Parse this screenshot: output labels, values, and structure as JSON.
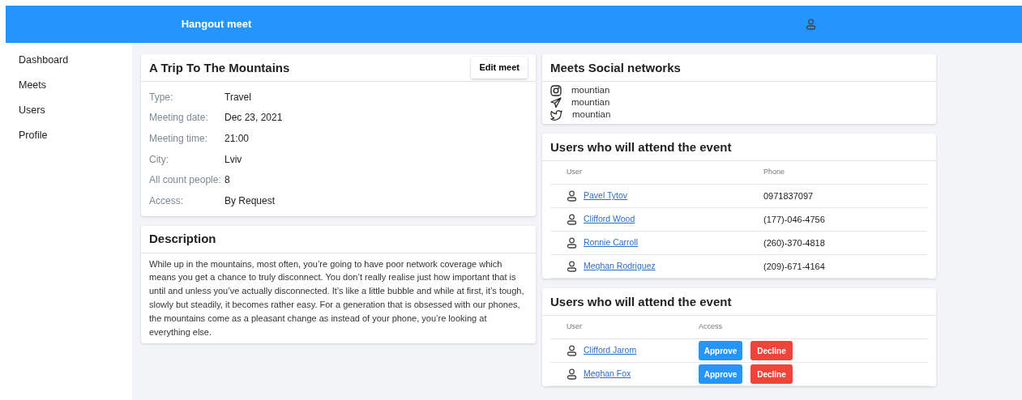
{
  "navbar": {
    "title": "Hangout meet"
  },
  "sidebar": {
    "items": [
      {
        "label": "Dashboard"
      },
      {
        "label": "Meets"
      },
      {
        "label": "Users"
      },
      {
        "label": "Profile"
      }
    ]
  },
  "meet": {
    "title": "A Trip To The Mountains",
    "edit_button": "Edit meet",
    "fields": [
      {
        "label": "Type:",
        "value": "Travel"
      },
      {
        "label": "Meeting date:",
        "value": "Dec 23, 2021"
      },
      {
        "label": "Meeting time:",
        "value": "21:00"
      },
      {
        "label": "City:",
        "value": "Lviv"
      },
      {
        "label": "All count people:",
        "value": "8"
      },
      {
        "label": "Access:",
        "value": "By Request"
      }
    ]
  },
  "description": {
    "title": "Description",
    "text": "While up in the mountains, most often, you’re going to have poor network coverage which means you get a chance to truly disconnect. You don’t really realise just how important that is until and unless you’ve actually disconnected. It’s like a little bubble and while at first, it’s tough, slowly but steadily, it becomes rather easy. For a generation that is obsessed with our phones, the mountains come as a pleasant change as instead of your phone, you’re looking at everything else."
  },
  "social": {
    "title": "Meets Social networks",
    "items": [
      {
        "kind": "instagram",
        "handle": "mountian"
      },
      {
        "kind": "telegram",
        "handle": "mountian"
      },
      {
        "kind": "twitter",
        "handle": "mountian"
      }
    ]
  },
  "attendees": {
    "title": "Users who will attend the event",
    "columns": [
      "User",
      "Phone"
    ],
    "rows": [
      {
        "name": "Pavel Tytov",
        "phone": "0971837097"
      },
      {
        "name": "Clifford Wood",
        "phone": "(177)-046-4756"
      },
      {
        "name": "Ronnie Carroll",
        "phone": "(260)-370-4818"
      },
      {
        "name": "Meghan Rodriguez",
        "phone": "(209)-671-4164"
      }
    ]
  },
  "requests": {
    "title": "Users who will attend the event",
    "columns": [
      "User",
      "Access"
    ],
    "rows": [
      {
        "name": "Clifford Jarom",
        "approve": "Approve",
        "decline": "Decline"
      },
      {
        "name": "Meghan Fox",
        "approve": "Approve",
        "decline": "Decline"
      }
    ]
  }
}
